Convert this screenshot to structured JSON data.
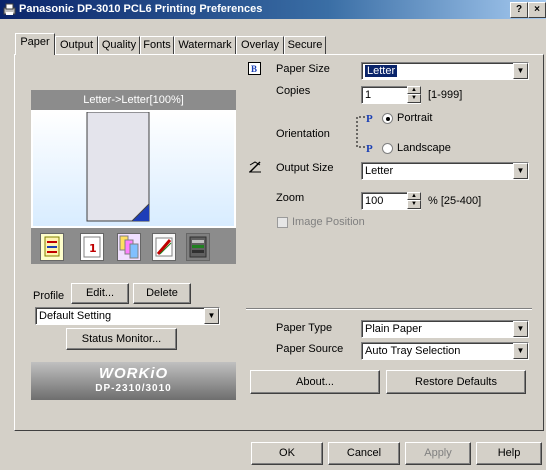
{
  "window": {
    "title": "Panasonic DP-3010 PCL6 Printing Preferences",
    "help_btn": "?",
    "close_btn": "×"
  },
  "tabs": [
    {
      "label": "Paper",
      "active": true
    },
    {
      "label": "Output"
    },
    {
      "label": "Quality"
    },
    {
      "label": "Fonts"
    },
    {
      "label": "Watermark"
    },
    {
      "label": "Overlay"
    },
    {
      "label": "Secure"
    }
  ],
  "preview": {
    "header": "Letter->Letter[100%]"
  },
  "quick_icons": [
    {
      "name": "output-settings-icon",
      "glyph": "≡"
    },
    {
      "name": "copies-icon",
      "glyph": "1"
    },
    {
      "name": "collate-icon",
      "glyph": "▥"
    },
    {
      "name": "stamp-icon",
      "glyph": "✎"
    },
    {
      "name": "color-icon",
      "glyph": "▦"
    }
  ],
  "profile": {
    "label": "Profile",
    "edit_btn": "Edit...",
    "delete_btn": "Delete",
    "selected": "Default Setting",
    "status_monitor_btn": "Status Monitor..."
  },
  "logo": {
    "brand": "WORKiO",
    "model": "DP-2310/3010"
  },
  "paper": {
    "paper_size_label": "Paper Size",
    "paper_size_value": "Letter",
    "copies_label": "Copies",
    "copies_value": "1",
    "copies_range": "[1-999]",
    "orientation_label": "Orientation",
    "portrait_label": "Portrait",
    "landscape_label": "Landscape",
    "orientation_selected": "Portrait",
    "output_size_label": "Output Size",
    "output_size_value": "Letter",
    "zoom_label": "Zoom",
    "zoom_value": "100",
    "zoom_range": "% [25-400]",
    "image_position_label": "Image Position",
    "paper_type_label": "Paper Type",
    "paper_type_value": "Plain Paper",
    "paper_source_label": "Paper Source",
    "paper_source_value": "Auto Tray Selection",
    "about_btn": "About...",
    "restore_btn": "Restore Defaults"
  },
  "footer": {
    "ok": "OK",
    "cancel": "Cancel",
    "apply": "Apply",
    "help": "Help"
  },
  "colors": {
    "title_start": "#0a246a",
    "title_end": "#a6caf0",
    "face": "#d4d0c8",
    "select_highlight": "#0a246a"
  }
}
